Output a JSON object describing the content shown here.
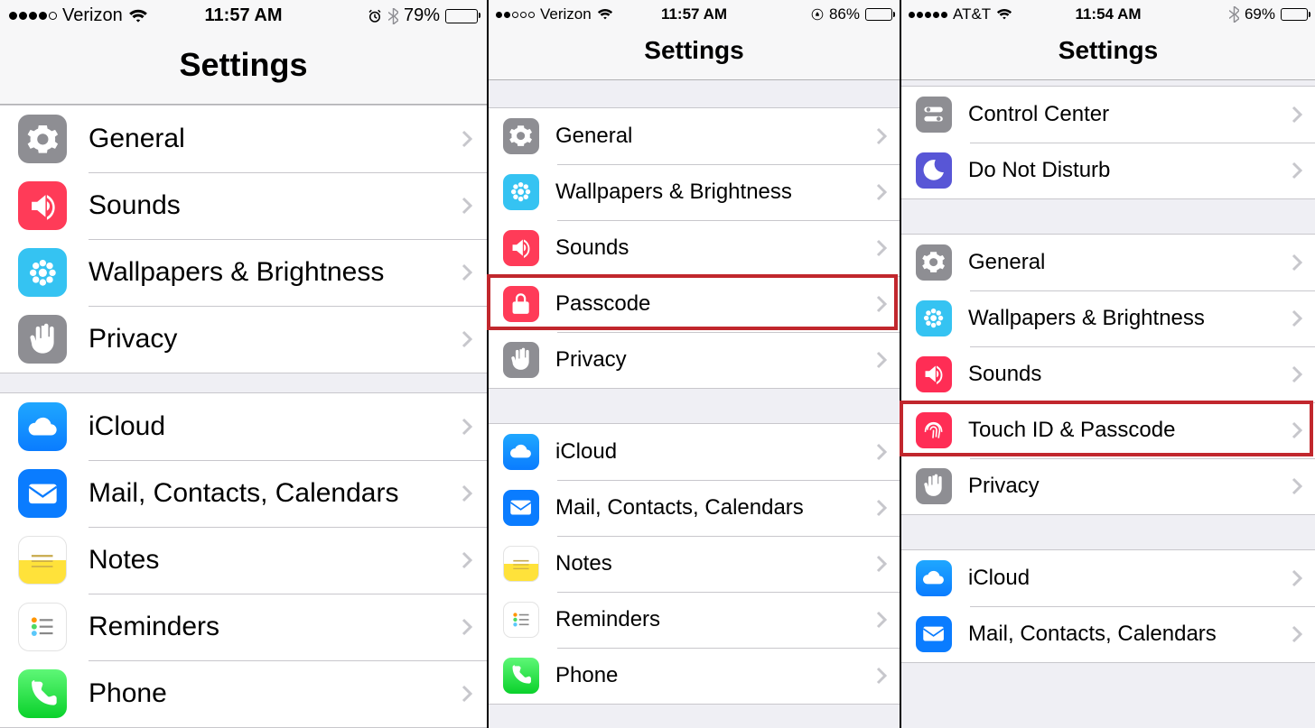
{
  "phones": [
    {
      "status": {
        "signal": 4,
        "carrier": "Verizon",
        "time": "11:57 AM",
        "alarm": true,
        "bt": true,
        "lock": false,
        "pct": "79%",
        "battFill": 79
      },
      "title": "Settings",
      "highlight": null,
      "groups": [
        [
          {
            "id": "general",
            "label": "General",
            "icon": "gear",
            "bg": "bg-gray"
          },
          {
            "id": "sounds",
            "label": "Sounds",
            "icon": "sound",
            "bg": "bg-red"
          },
          {
            "id": "wallpapers",
            "label": "Wallpapers & Brightness",
            "icon": "flower",
            "bg": "bg-cyan"
          },
          {
            "id": "privacy",
            "label": "Privacy",
            "icon": "hand",
            "bg": "bg-gray"
          }
        ],
        [
          {
            "id": "icloud",
            "label": "iCloud",
            "icon": "cloud",
            "bg": "bg-bluegr"
          },
          {
            "id": "mail",
            "label": "Mail, Contacts, Calendars",
            "icon": "mail",
            "bg": "bg-blue"
          },
          {
            "id": "notes",
            "label": "Notes",
            "icon": "notes",
            "bg": "bg-yellow"
          },
          {
            "id": "reminders",
            "label": "Reminders",
            "icon": "reminders",
            "bg": "bg-white"
          },
          {
            "id": "phone",
            "label": "Phone",
            "icon": "phone",
            "bg": "bg-green"
          }
        ]
      ]
    },
    {
      "status": {
        "signal": 2,
        "carrier": "Verizon",
        "time": "11:57 AM",
        "alarm": false,
        "bt": false,
        "lock": true,
        "pct": "86%",
        "battFill": 86
      },
      "title": "Settings",
      "highlight": "passcode",
      "groups": [
        [
          {
            "id": "general",
            "label": "General",
            "icon": "gear",
            "bg": "bg-gray"
          },
          {
            "id": "wallpapers",
            "label": "Wallpapers & Brightness",
            "icon": "flower",
            "bg": "bg-cyan"
          },
          {
            "id": "sounds",
            "label": "Sounds",
            "icon": "sound",
            "bg": "bg-red"
          },
          {
            "id": "passcode",
            "label": "Passcode",
            "icon": "lock",
            "bg": "bg-red"
          },
          {
            "id": "privacy",
            "label": "Privacy",
            "icon": "hand",
            "bg": "bg-gray"
          }
        ],
        [
          {
            "id": "icloud",
            "label": "iCloud",
            "icon": "cloud",
            "bg": "bg-bluegr"
          },
          {
            "id": "mail",
            "label": "Mail, Contacts, Calendars",
            "icon": "mail",
            "bg": "bg-blue"
          },
          {
            "id": "notes",
            "label": "Notes",
            "icon": "notes",
            "bg": "bg-yellow"
          },
          {
            "id": "reminders",
            "label": "Reminders",
            "icon": "reminders",
            "bg": "bg-white"
          },
          {
            "id": "phone",
            "label": "Phone",
            "icon": "phone",
            "bg": "bg-green"
          }
        ]
      ]
    },
    {
      "status": {
        "signal": 5,
        "carrier": "AT&T",
        "time": "11:54 AM",
        "alarm": false,
        "bt": true,
        "lock": false,
        "pct": "69%",
        "battFill": 69
      },
      "title": "Settings",
      "highlight": "touchid",
      "groups": [
        [
          {
            "id": "controlcenter",
            "label": "Control Center",
            "icon": "toggles",
            "bg": "bg-gray"
          },
          {
            "id": "dnd",
            "label": "Do Not Disturb",
            "icon": "moon",
            "bg": "bg-purple"
          }
        ],
        [
          {
            "id": "general",
            "label": "General",
            "icon": "gear",
            "bg": "bg-gray"
          },
          {
            "id": "wallpapers",
            "label": "Wallpapers & Brightness",
            "icon": "flower",
            "bg": "bg-cyan"
          },
          {
            "id": "sounds",
            "label": "Sounds",
            "icon": "sound",
            "bg": "bg-pink"
          },
          {
            "id": "touchid",
            "label": "Touch ID & Passcode",
            "icon": "fingerprint",
            "bg": "bg-pink"
          },
          {
            "id": "privacy",
            "label": "Privacy",
            "icon": "hand",
            "bg": "bg-gray"
          }
        ],
        [
          {
            "id": "icloud",
            "label": "iCloud",
            "icon": "cloud",
            "bg": "bg-bluegr"
          },
          {
            "id": "mail",
            "label": "Mail, Contacts, Calendars",
            "icon": "mail",
            "bg": "bg-blue"
          }
        ]
      ]
    }
  ]
}
